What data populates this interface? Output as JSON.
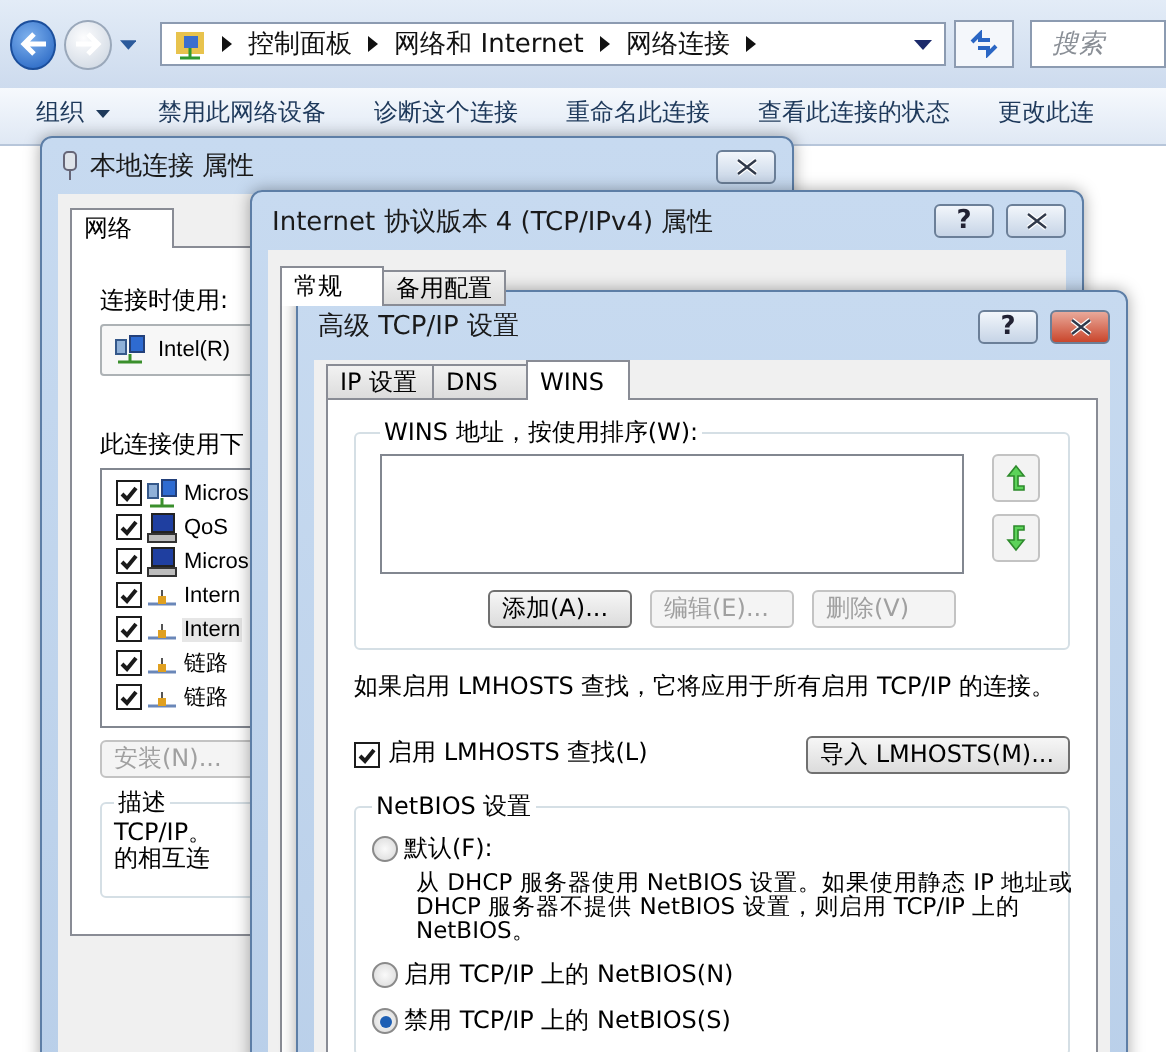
{
  "explorer": {
    "breadcrumb": [
      "控制面板",
      "网络和 Internet",
      "网络连接"
    ],
    "search_placeholder": "搜索",
    "toolbar": [
      {
        "label": "组织",
        "kind": "menu"
      },
      {
        "label": "禁用此网络设备",
        "kind": "command"
      },
      {
        "label": "诊断这个连接",
        "kind": "command"
      },
      {
        "label": "重命名此连接",
        "kind": "command"
      },
      {
        "label": "查看此连接的状态",
        "kind": "command"
      },
      {
        "label": "更改此连",
        "kind": "command"
      }
    ]
  },
  "local_connection": {
    "title": "本地连接 属性",
    "tabs": [
      {
        "label": "网络",
        "selected": true
      }
    ],
    "connect_using_label": "连接时使用:",
    "adapter": "Intel(R)",
    "components_label": "此连接使用下",
    "components": [
      {
        "name": "Micros",
        "checked": true,
        "selected": false,
        "kind": "network"
      },
      {
        "name": "QoS",
        "checked": true,
        "selected": false,
        "kind": "computer"
      },
      {
        "name": "Micros",
        "checked": true,
        "selected": false,
        "kind": "computer"
      },
      {
        "name": "Intern",
        "checked": true,
        "selected": false,
        "kind": "protocol"
      },
      {
        "name": "Intern",
        "checked": true,
        "selected": true,
        "kind": "protocol"
      },
      {
        "name": "链路",
        "checked": true,
        "selected": false,
        "kind": "protocol"
      },
      {
        "name": "链路",
        "checked": true,
        "selected": false,
        "kind": "protocol"
      }
    ],
    "install_button": {
      "label": "安装(N)...",
      "disabled": true
    },
    "description": {
      "legend": "描述",
      "lines": [
        "TCP/IP。",
        "的相互连"
      ]
    }
  },
  "tcpipv4": {
    "title": "Internet 协议版本 4 (TCP/IPv4) 属性",
    "help_glyph": "?",
    "tabs": [
      {
        "label": "常规",
        "selected": true
      },
      {
        "label": "备用配置",
        "selected": false
      }
    ]
  },
  "advanced": {
    "title": "高级 TCP/IP 设置",
    "help_glyph": "?",
    "tabs": [
      {
        "label": "IP 设置",
        "selected": false
      },
      {
        "label": "DNS",
        "selected": false
      },
      {
        "label": "WINS",
        "selected": true
      }
    ],
    "wins_group": {
      "legend": "WINS 地址，按使用排序(W):",
      "buttons": [
        {
          "label": "添加(A)...",
          "disabled": false
        },
        {
          "label": "编辑(E)...",
          "disabled": true
        },
        {
          "label": "删除(V)",
          "disabled": true
        }
      ]
    },
    "lmhosts_note": "如果启用 LMHOSTS 查找，它将应用于所有启用 TCP/IP 的连接。",
    "lmhosts_checkbox": {
      "label": "启用 LMHOSTS 查找(L)",
      "checked": true
    },
    "import_button": {
      "label": "导入 LMHOSTS(M)..."
    },
    "netbios": {
      "legend": "NetBIOS 设置",
      "options": [
        {
          "label": "默认(F):",
          "selected": false,
          "description": "从 DHCP 服务器使用 NetBIOS 设置。如果使用静态 IP 地址或 DHCP 服务器不提供 NetBIOS 设置，则启用 TCP/IP 上的 NetBIOS。"
        },
        {
          "label": "启用 TCP/IP 上的 NetBIOS(N)",
          "selected": false
        },
        {
          "label": "禁用 TCP/IP 上的 NetBIOS(S)",
          "selected": true
        }
      ]
    }
  }
}
